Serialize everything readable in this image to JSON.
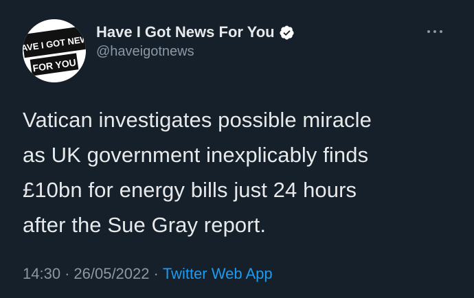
{
  "author": {
    "display_name": "Have I Got News For You",
    "handle": "@haveigotnews",
    "verified": true,
    "avatar_text_top": "HAVE I GOT NEWS",
    "avatar_text_bottom": "FOR YOU"
  },
  "tweet": {
    "text_lines": [
      "Vatican investigates possible miracle",
      "as UK government inexplicably finds",
      "£10bn for energy bills just 24 hours",
      "after the Sue Gray report."
    ]
  },
  "meta": {
    "time": "14:30",
    "separator": "·",
    "date": "26/05/2022",
    "source": "Twitter Web App"
  },
  "icons": {
    "verified": "verified-badge-icon",
    "more": "more-options-icon"
  },
  "colors": {
    "background": "#15202b",
    "text": "#e7e9ea",
    "secondary": "#8b98a5",
    "link": "#1d9bf0"
  }
}
